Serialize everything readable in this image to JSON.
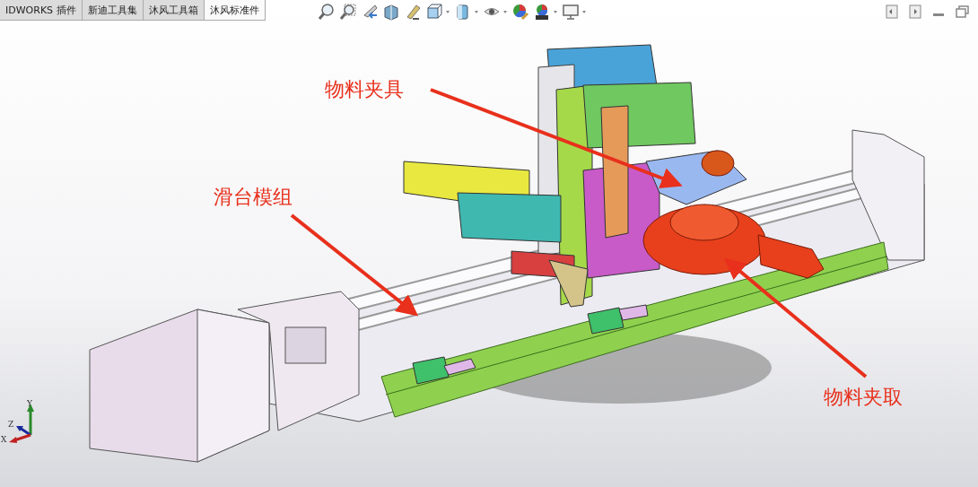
{
  "tabs": [
    {
      "label": "IDWORKS 插件",
      "selected": false
    },
    {
      "label": "新迪工具集",
      "selected": false
    },
    {
      "label": "沐风工具箱",
      "selected": false
    },
    {
      "label": "沐风标准件",
      "selected": true
    }
  ],
  "annotations": [
    {
      "text": "物料夹具"
    },
    {
      "text": "滑台模组"
    },
    {
      "text": "物料夹取"
    }
  ],
  "triad": {
    "labels": [
      "Y",
      "Z",
      "X"
    ]
  }
}
